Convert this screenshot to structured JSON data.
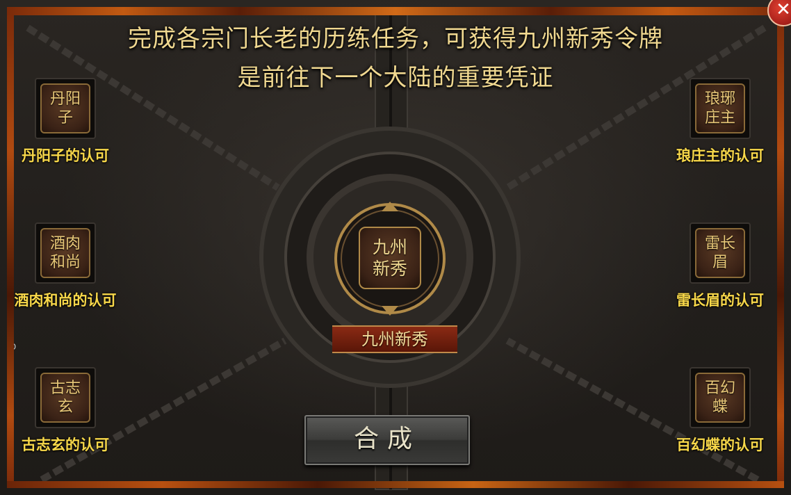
{
  "header": {
    "line1": "完成各宗门长老的历练任务，可获得九州新秀令牌",
    "line2": "是前往下一个大陆的重要凭证"
  },
  "elders": [
    {
      "tile_text": "丹阳子",
      "label": "丹阳子的认可"
    },
    {
      "tile_text": "琅琊庄主",
      "label": "琅庄主的认可"
    },
    {
      "tile_text": "酒肉和尚",
      "label": "酒肉和尚的认可"
    },
    {
      "tile_text": "雷长眉",
      "label": "雷长眉的认可"
    },
    {
      "tile_text": "古志玄",
      "label": "古志玄的认可"
    },
    {
      "tile_text": "百幻蝶",
      "label": "百幻蝶的认可"
    }
  ],
  "emblem": {
    "text": "九州新秀",
    "banner": "九州新秀"
  },
  "combine_button": "合成",
  "stray_text": "D",
  "colors": {
    "title_gold": "#f0d890",
    "label_yellow": "#f8d84a",
    "banner_red": "#8a2a14"
  }
}
